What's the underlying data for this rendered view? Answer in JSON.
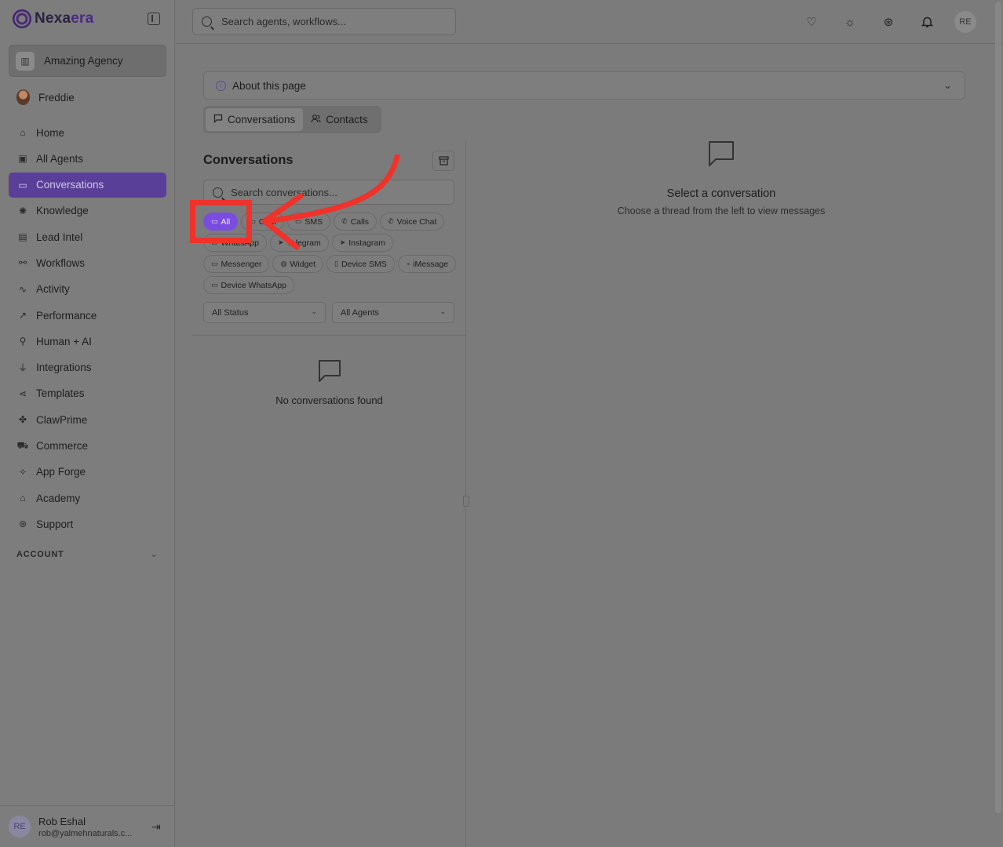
{
  "app": {
    "brand": {
      "name_part1": "Nexa",
      "name_part2": "era"
    },
    "org": "Amazing Agency",
    "user": "Freddie"
  },
  "sidebar": {
    "items": [
      {
        "label": "Home",
        "icon": "home-icon",
        "active": false
      },
      {
        "label": "All Agents",
        "icon": "briefcase-icon",
        "active": false
      },
      {
        "label": "Conversations",
        "icon": "chat-icon",
        "active": true
      },
      {
        "label": "Knowledge",
        "icon": "brain-icon",
        "active": false
      },
      {
        "label": "Lead Intel",
        "icon": "contact-card-icon",
        "active": false
      },
      {
        "label": "Workflows",
        "icon": "workflow-icon",
        "active": false
      },
      {
        "label": "Activity",
        "icon": "activity-icon",
        "active": false
      },
      {
        "label": "Performance",
        "icon": "trending-up-icon",
        "active": false
      },
      {
        "label": "Human + AI",
        "icon": "network-icon",
        "active": false
      },
      {
        "label": "Integrations",
        "icon": "plug-icon",
        "active": false
      },
      {
        "label": "Templates",
        "icon": "share-icon",
        "active": false
      },
      {
        "label": "ClawPrime",
        "icon": "claw-icon",
        "active": false
      },
      {
        "label": "Commerce",
        "icon": "cart-icon",
        "active": false
      },
      {
        "label": "App Forge",
        "icon": "sparkle-icon",
        "active": false
      },
      {
        "label": "Academy",
        "icon": "graduation-cap-icon",
        "active": false
      },
      {
        "label": "Support",
        "icon": "lifebuoy-icon",
        "active": false
      }
    ],
    "account_label": "ACCOUNT",
    "footer": {
      "initials": "RE",
      "name": "Rob Eshal",
      "email": "rob@yalmehnaturals.c..."
    }
  },
  "topbar": {
    "search_placeholder": "Search agents, workflows...",
    "icons": [
      "heart-icon",
      "sun-icon",
      "lifebuoy-icon",
      "bell-icon"
    ],
    "avatar_initials": "RE"
  },
  "main": {
    "about_label": "About this page",
    "tabs": [
      {
        "label": "Conversations",
        "active": true
      },
      {
        "label": "Contacts",
        "active": false
      }
    ],
    "list": {
      "title": "Conversations",
      "search_placeholder": "Search conversations...",
      "chips": [
        {
          "label": "All",
          "icon": "chat-icon",
          "active": true
        },
        {
          "label": "Chat",
          "icon": "chat-icon",
          "active": false
        },
        {
          "label": "SMS",
          "icon": "chat-icon",
          "active": false
        },
        {
          "label": "Calls",
          "icon": "phone-icon",
          "active": false
        },
        {
          "label": "Voice Chat",
          "icon": "phone-icon",
          "active": false
        },
        {
          "label": "WhatsApp",
          "icon": "chat-icon",
          "active": false
        },
        {
          "label": "Telegram",
          "icon": "send-icon",
          "active": false
        },
        {
          "label": "Instagram",
          "icon": "send-icon",
          "active": false
        },
        {
          "label": "Messenger",
          "icon": "chat-icon",
          "active": false
        },
        {
          "label": "Widget",
          "icon": "globe-icon",
          "active": false
        },
        {
          "label": "Device SMS",
          "icon": "device-icon",
          "active": false
        },
        {
          "label": "iMessage",
          "icon": "apple-icon",
          "active": false
        },
        {
          "label": "Device WhatsApp",
          "icon": "chat-icon",
          "active": false
        }
      ],
      "status_filter": "All Status",
      "agent_filter": "All Agents",
      "empty_text": "No conversations found"
    },
    "detail": {
      "title": "Select a conversation",
      "subtitle": "Choose a thread from the left to view messages"
    }
  },
  "colors": {
    "accent": "#7a4de0",
    "annotation": "#f0322a"
  }
}
